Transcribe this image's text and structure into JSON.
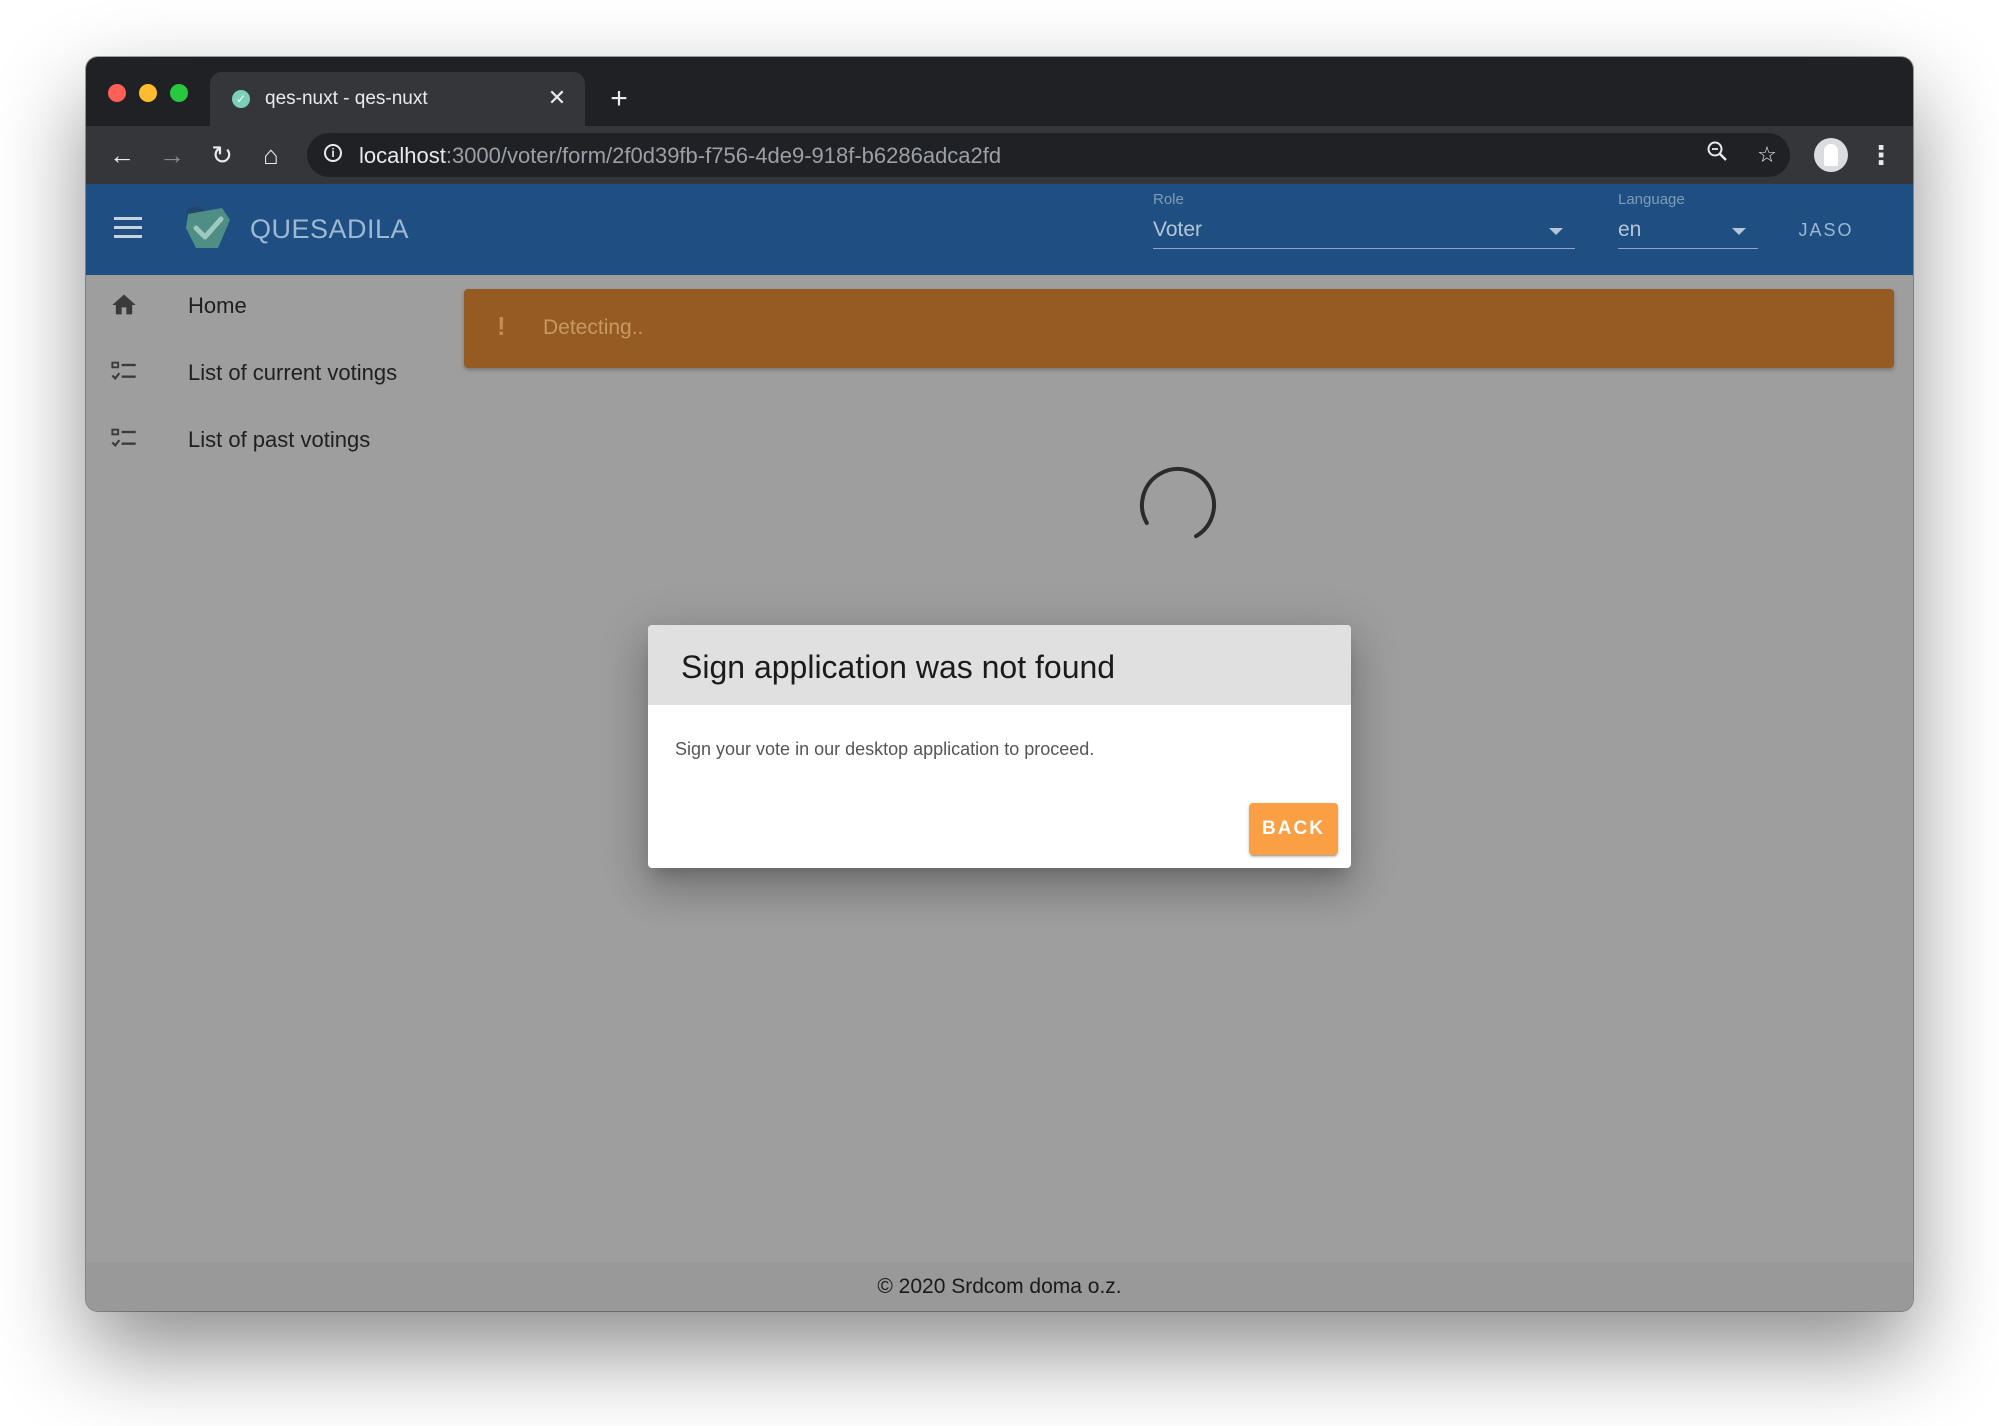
{
  "browser": {
    "tab_title": "qes-nuxt - qes-nuxt",
    "url_host": "localhost",
    "url_path": ":3000/voter/form/2f0d39fb-f756-4de9-918f-b6286adca2fd"
  },
  "app_bar": {
    "brand": "QUESADILA",
    "role_label": "Role",
    "role_value": "Voter",
    "language_label": "Language",
    "language_value": "en",
    "user_button": "JASO",
    "colors": {
      "primary": "#1f4f82",
      "accent": "#fb9f45",
      "warning": "#955b23"
    }
  },
  "sidebar": {
    "items": [
      {
        "label": "Home",
        "icon": "home-icon"
      },
      {
        "label": "List of current votings",
        "icon": "checklist-icon"
      },
      {
        "label": "List of past votings",
        "icon": "checklist-icon"
      }
    ]
  },
  "alert": {
    "icon": "!",
    "text": "Detecting.."
  },
  "dialog": {
    "title": "Sign application was not found",
    "message": "Sign your vote in our desktop application to proceed.",
    "back_button": "BACK"
  },
  "footer": {
    "text": "© 2020 Srdcom doma o.z."
  }
}
